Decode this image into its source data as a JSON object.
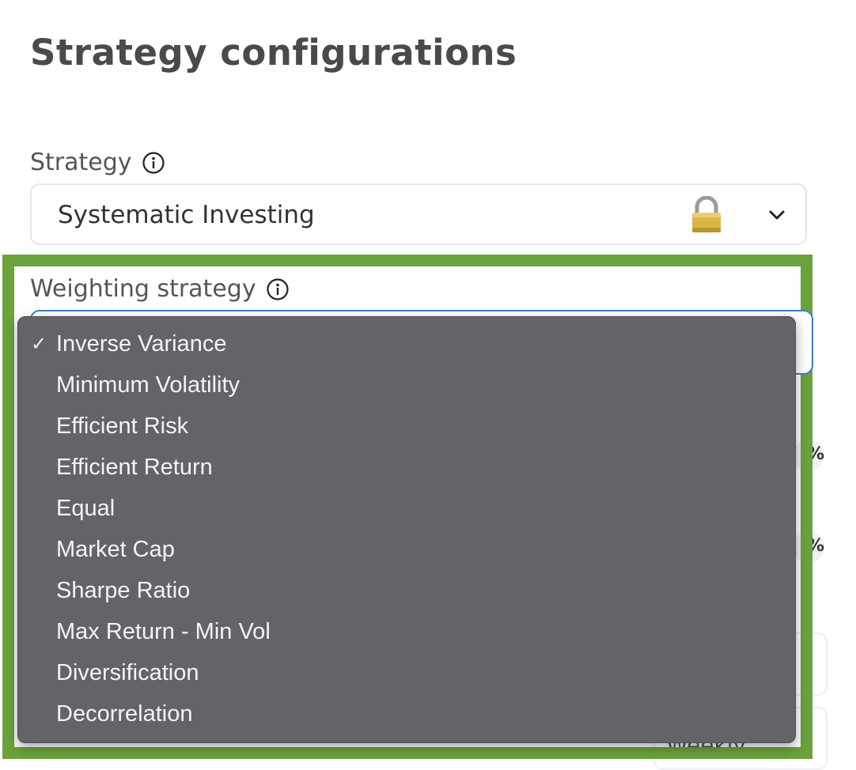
{
  "page": {
    "title": "Strategy configurations"
  },
  "strategy": {
    "label": "Strategy",
    "value": "Systematic Investing",
    "locked": true
  },
  "weighting": {
    "label": "Weighting strategy",
    "selected": "Inverse Variance",
    "options": [
      "Inverse Variance",
      "Minimum Volatility",
      "Efficient Risk",
      "Efficient Return",
      "Equal",
      "Market Cap",
      "Sharpe Ratio",
      "Max Return - Min Vol",
      "Diversification",
      "Decorrelation"
    ]
  },
  "background": {
    "pct1": "%",
    "pct2": "%",
    "weekly": "Weekly"
  },
  "colors": {
    "highlight": "#6aa33c",
    "menu_bg": "#646369",
    "focus_border": "#3d7bc6"
  }
}
